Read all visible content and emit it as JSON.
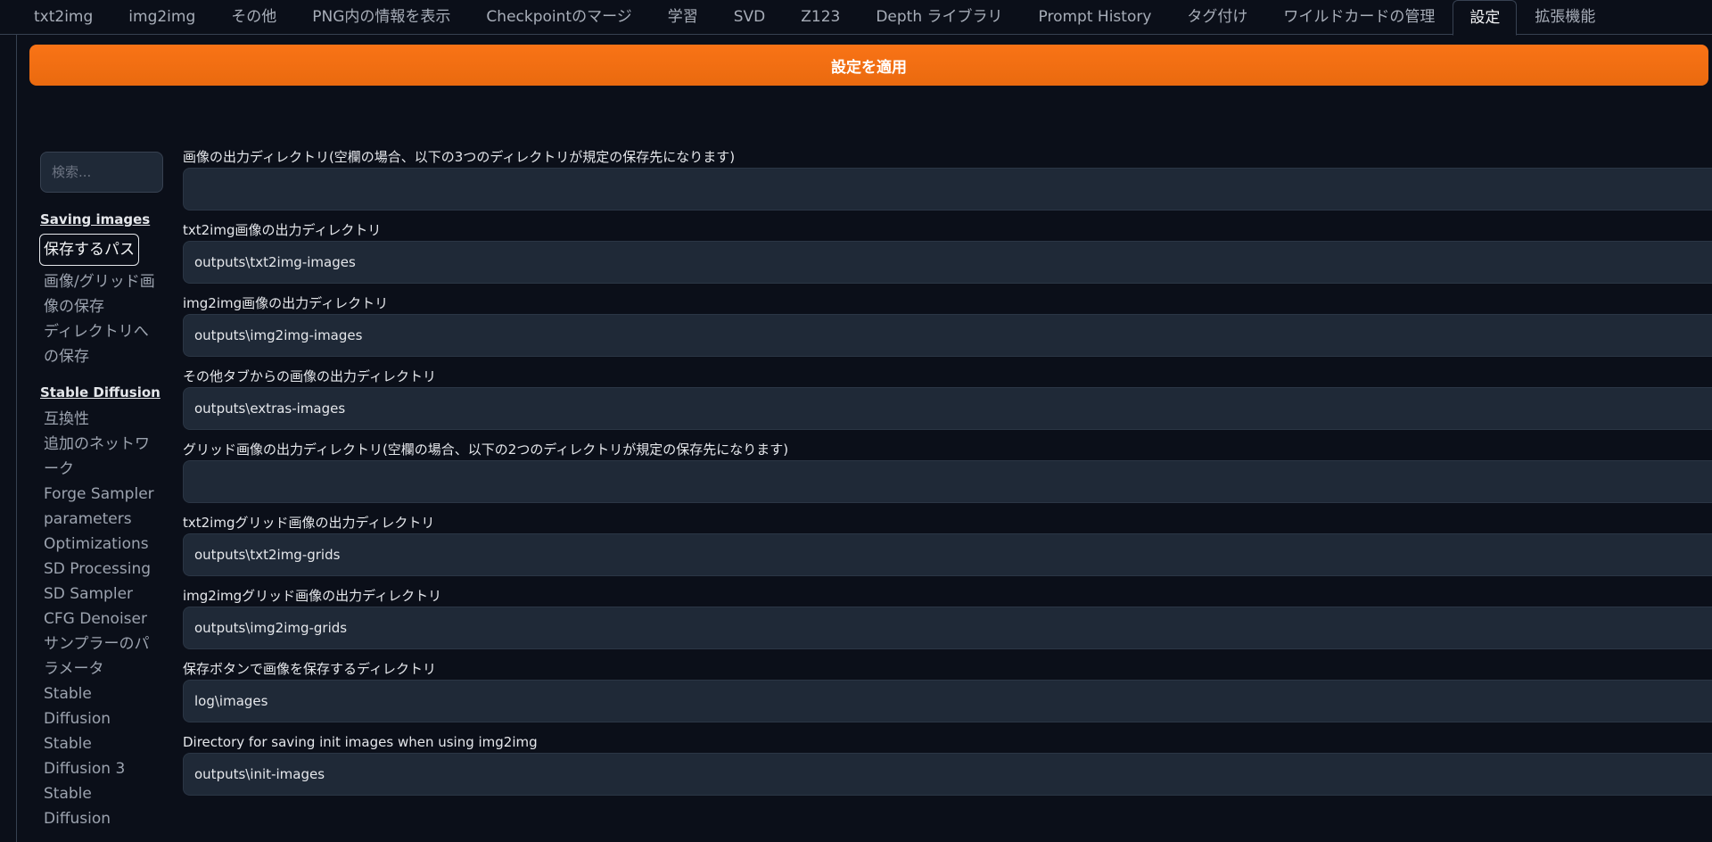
{
  "tabs": [
    {
      "label": "txt2img"
    },
    {
      "label": "img2img"
    },
    {
      "label": "その他"
    },
    {
      "label": "PNG内の情報を表示"
    },
    {
      "label": "Checkpointのマージ"
    },
    {
      "label": "学習"
    },
    {
      "label": "SVD"
    },
    {
      "label": "Z123"
    },
    {
      "label": "Depth ライブラリ"
    },
    {
      "label": "Prompt History"
    },
    {
      "label": "タグ付け"
    },
    {
      "label": "ワイルドカードの管理"
    },
    {
      "label": "設定"
    },
    {
      "label": "拡張機能"
    }
  ],
  "active_tab": "設定",
  "apply_button_label": "設定を適用",
  "search": {
    "placeholder": "検索..."
  },
  "sidebar": {
    "section1": "Saving images",
    "section1_items": [
      "保存するパス",
      "画像/グリッド画像の保存",
      "ディレクトリへの保存"
    ],
    "section2": "Stable Diffusion",
    "section2_items": [
      "互換性",
      "追加のネットワーク",
      "Forge Sampler parameters",
      "Optimizations",
      "SD Processing",
      "SD Sampler CFG Denoiser",
      "サンプラーのパラメータ",
      "Stable Diffusion",
      "Stable Diffusion 3",
      "Stable Diffusion"
    ]
  },
  "settings": [
    {
      "label": "画像の出力ディレクトリ(空欄の場合、以下の3つのディレクトリが規定の保存先になります)",
      "value": ""
    },
    {
      "label": "txt2img画像の出力ディレクトリ",
      "value": "outputs\\txt2img-images"
    },
    {
      "label": "img2img画像の出力ディレクトリ",
      "value": "outputs\\img2img-images"
    },
    {
      "label": "その他タブからの画像の出力ディレクトリ",
      "value": "outputs\\extras-images"
    },
    {
      "label": "グリッド画像の出力ディレクトリ(空欄の場合、以下の2つのディレクトリが規定の保存先になります)",
      "value": ""
    },
    {
      "label": "txt2imgグリッド画像の出力ディレクトリ",
      "value": "outputs\\txt2img-grids"
    },
    {
      "label": "img2imgグリッド画像の出力ディレクトリ",
      "value": "outputs\\img2img-grids"
    },
    {
      "label": "保存ボタンで画像を保存するディレクトリ",
      "value": "log\\images"
    },
    {
      "label": "Directory for saving init images when using img2img",
      "value": "outputs\\init-images"
    }
  ],
  "colors": {
    "accent": "#f97316",
    "background": "#0b0f19",
    "input_bg": "#1f2937"
  }
}
